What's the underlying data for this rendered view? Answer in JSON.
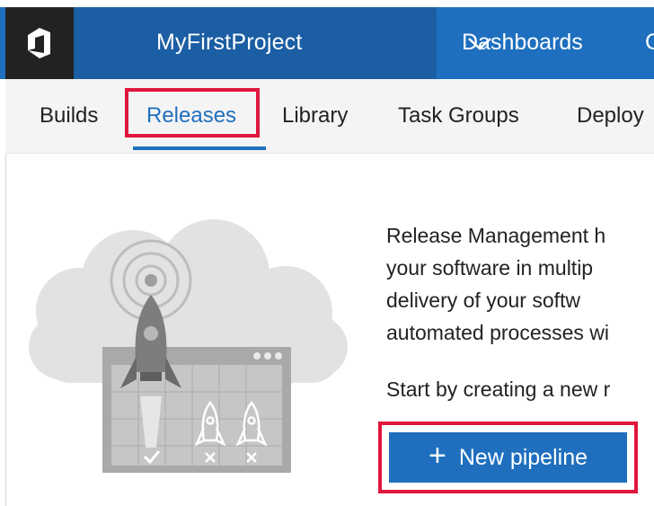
{
  "header": {
    "project_name": "MyFirstProject",
    "dropdown_icon": "chevron-down-icon",
    "dashboards_label": "Dashboards",
    "next_tab_partial": "C"
  },
  "subnav": {
    "items": [
      {
        "label": "Builds"
      },
      {
        "label": "Releases",
        "active": true
      },
      {
        "label": "Library"
      },
      {
        "label": "Task Groups"
      },
      {
        "label": "Deploy"
      }
    ]
  },
  "empty_state": {
    "description_lines": [
      "Release Management h",
      "your software in multip",
      "delivery of your softw",
      "automated processes wi"
    ],
    "start_text": "Start by creating a new r",
    "button_label": "New pipeline",
    "button_icon": "plus-icon"
  },
  "colors": {
    "accent": "#1f6fbe",
    "highlight": "#e0163b",
    "header_dark": "#222222",
    "header_project": "#1b5ea3",
    "header_main": "#1e6fbf"
  }
}
